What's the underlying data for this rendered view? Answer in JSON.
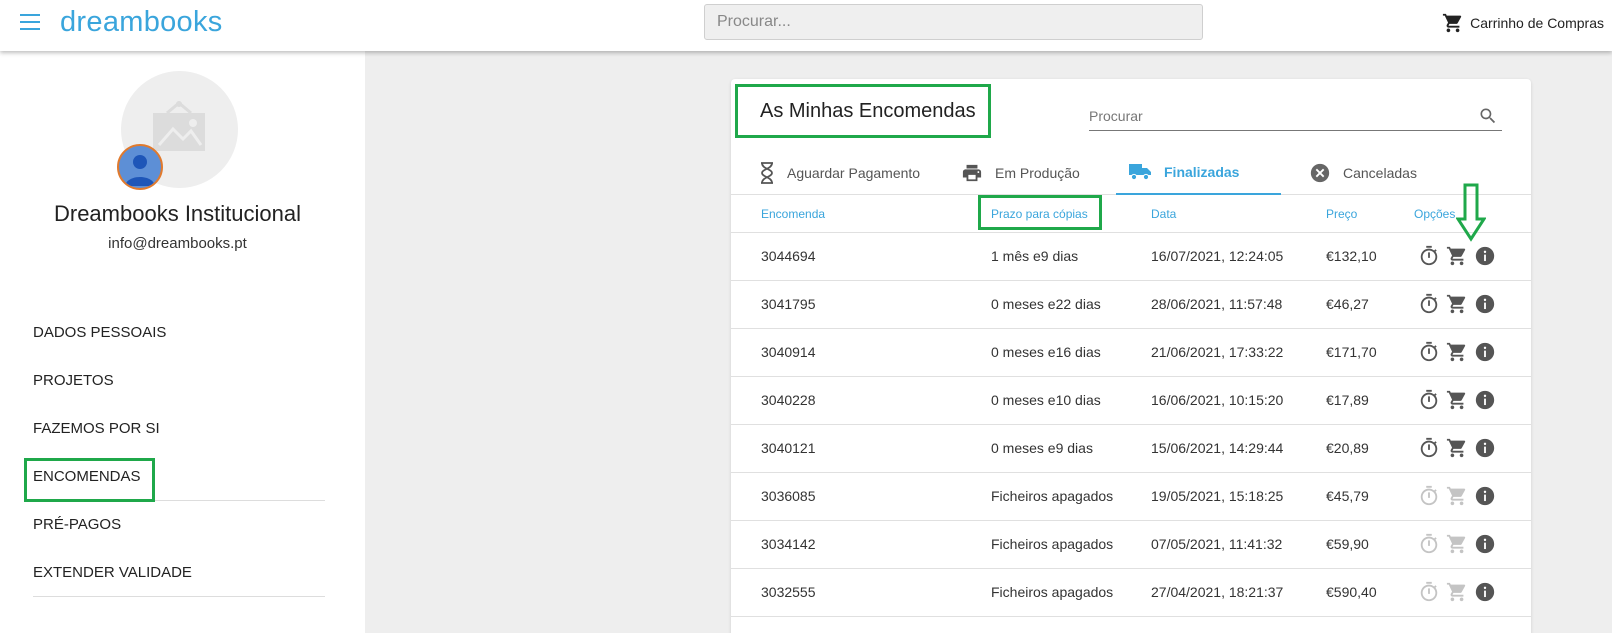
{
  "topbar": {
    "logo": "dreambooks",
    "search_placeholder": "Procurar...",
    "cart_label": "Carrinho de Compras"
  },
  "profile": {
    "name": "Dreambooks Institucional",
    "email": "info@dreambooks.pt"
  },
  "nav": {
    "items": [
      {
        "label": "DADOS PESSOAIS"
      },
      {
        "label": "PROJETOS"
      },
      {
        "label": "FAZEMOS POR SI"
      },
      {
        "label": "ENCOMENDAS"
      },
      {
        "label": "PRÉ-PAGOS"
      },
      {
        "label": "EXTENDER VALIDADE"
      }
    ],
    "active_index": 3
  },
  "orders": {
    "title": "As Minhas Encomendas",
    "search_placeholder": "Procurar",
    "tabs": [
      {
        "label": "Aguardar Pagamento",
        "icon": "hourglass-icon"
      },
      {
        "label": "Em Produção",
        "icon": "printer-icon"
      },
      {
        "label": "Finalizadas",
        "icon": "truck-icon"
      },
      {
        "label": "Canceladas",
        "icon": "cancel-icon"
      }
    ],
    "active_tab": 2,
    "columns": {
      "order": "Encomenda",
      "deadline": "Prazo para cópias",
      "date": "Data",
      "price": "Preço",
      "options": "Opções"
    },
    "rows": [
      {
        "id": "3044694",
        "deadline": "1 mês e9 dias",
        "date": "16/07/2021, 12:24:05",
        "price": "€132,10",
        "active": true
      },
      {
        "id": "3041795",
        "deadline": "0 meses e22 dias",
        "date": "28/06/2021, 11:57:48",
        "price": "€46,27",
        "active": true
      },
      {
        "id": "3040914",
        "deadline": "0 meses e16 dias",
        "date": "21/06/2021, 17:33:22",
        "price": "€171,70",
        "active": true
      },
      {
        "id": "3040228",
        "deadline": "0 meses e10 dias",
        "date": "16/06/2021, 10:15:20",
        "price": "€17,89",
        "active": true
      },
      {
        "id": "3040121",
        "deadline": "0 meses e9 dias",
        "date": "15/06/2021, 14:29:44",
        "price": "€20,89",
        "active": true
      },
      {
        "id": "3036085",
        "deadline": "Ficheiros apagados",
        "date": "19/05/2021, 15:18:25",
        "price": "€45,79",
        "active": false
      },
      {
        "id": "3034142",
        "deadline": "Ficheiros apagados",
        "date": "07/05/2021, 11:41:32",
        "price": "€59,90",
        "active": false
      },
      {
        "id": "3032555",
        "deadline": "Ficheiros apagados",
        "date": "27/04/2021, 18:21:37",
        "price": "€590,40",
        "active": false
      }
    ]
  },
  "colors": {
    "accent": "#3aa5dc",
    "highlight": "#1fa84a",
    "icon_active": "#555555",
    "icon_disabled": "#c4c4c4"
  }
}
